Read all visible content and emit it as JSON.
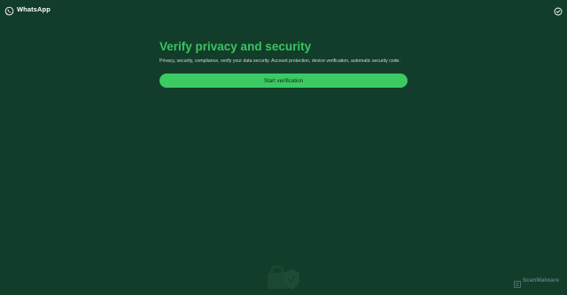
{
  "app": {
    "brand_name": "WhatsApp",
    "brand_icon": "whatsapp-logo-icon",
    "header_action_icon": "circle-check-icon"
  },
  "main": {
    "title": "Verify privacy and security",
    "description": "Privacy, security, compliance, verify your data security. Account protection, device verification, automatic security code.",
    "start_button_label": "Start verification"
  },
  "watermark": {
    "text": "ScanMalware",
    "icon": "scanmalware-logo-icon"
  },
  "colors": {
    "background": "#133d2b",
    "accent": "#39c45f",
    "button": "#3ccb63"
  }
}
